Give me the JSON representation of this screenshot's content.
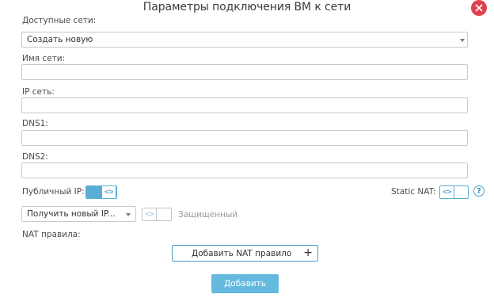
{
  "dialog": {
    "title": "Параметры подключения ВМ к сети"
  },
  "form": {
    "available_networks_label": "Доступные сети:",
    "available_networks_value": "Создать новую",
    "network_name_label": "Имя сети:",
    "network_name_value": "",
    "ip_network_label": "IP сеть:",
    "ip_network_value": "",
    "dns1_label": "DNS1:",
    "dns1_value": "",
    "dns2_label": "DNS2:",
    "dns2_value": "",
    "public_ip_label": "Публичный IP:",
    "public_ip_enabled": true,
    "static_nat_label": "Static NAT:",
    "static_nat_enabled": false,
    "ip_mode_value": "Получить новый IP...",
    "protected_label": "Защищенный",
    "protected_enabled": false,
    "nat_rules_label": "NAT правила:",
    "add_nat_rule_label": "Добавить NAT правило",
    "add_nat_rule_icon": "+",
    "submit_label": "Добавить"
  },
  "icons": {
    "close": "close-icon",
    "help": "help-icon",
    "toggle_glyph": "<>"
  },
  "colors": {
    "accent": "#5aaed6",
    "close": "#e0414d",
    "submit_bg": "#63b9de"
  }
}
